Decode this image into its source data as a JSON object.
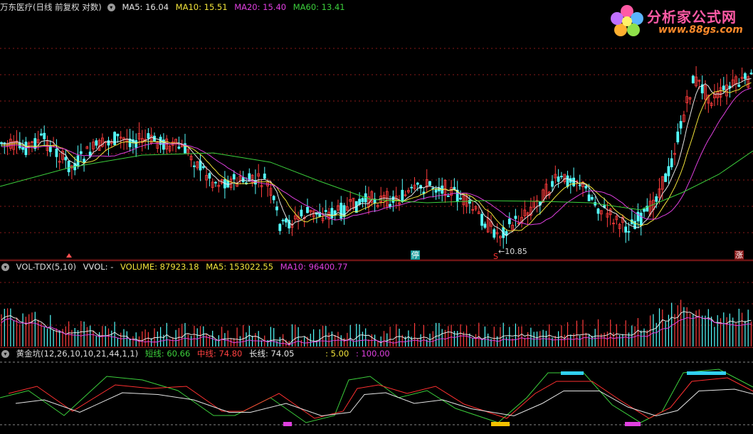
{
  "main": {
    "title": "万东医疗(日线 前复权 对数)",
    "collapse_icon": "chevron-down-icon",
    "ma": [
      {
        "label": "MA5: 16.04",
        "color": "#e6e6e6"
      },
      {
        "label": "MA10: 15.51",
        "color": "#f2e33a"
      },
      {
        "label": "MA20: 15.40",
        "color": "#e040e0"
      },
      {
        "label": "MA60: 13.41",
        "color": "#3ccf3c"
      }
    ],
    "low_price_label": "10.85",
    "markers": {
      "stop": "停",
      "sell": "S",
      "limit_up": "涨"
    }
  },
  "volume": {
    "title": "VOL-TDX(5,10)",
    "vvol": "VVOL: -",
    "volume": "VOLUME: 87923.18",
    "ma5": "MA5: 153022.55",
    "ma10": "MA10: 96400.77"
  },
  "indicator": {
    "title": "黄金坑(12,26,10,10,21,44,1,1)",
    "short_line": "短线: 60.66",
    "mid_line": "中线: 74.80",
    "long_line": "长线: 74.05",
    "v1": ": 5.00",
    "v2": ": 100.00"
  },
  "logo": {
    "title": "分析家公式网",
    "url": "www.88gs.com",
    "icon": "flower-logo-icon"
  },
  "colors": {
    "up": "#ff3c3c",
    "down": "#54ffff",
    "ma5": "#e6e6e6",
    "ma10": "#f2e33a",
    "ma20": "#e040e0",
    "ma60": "#3ccf3c",
    "grid": "#8b1a1a"
  }
}
